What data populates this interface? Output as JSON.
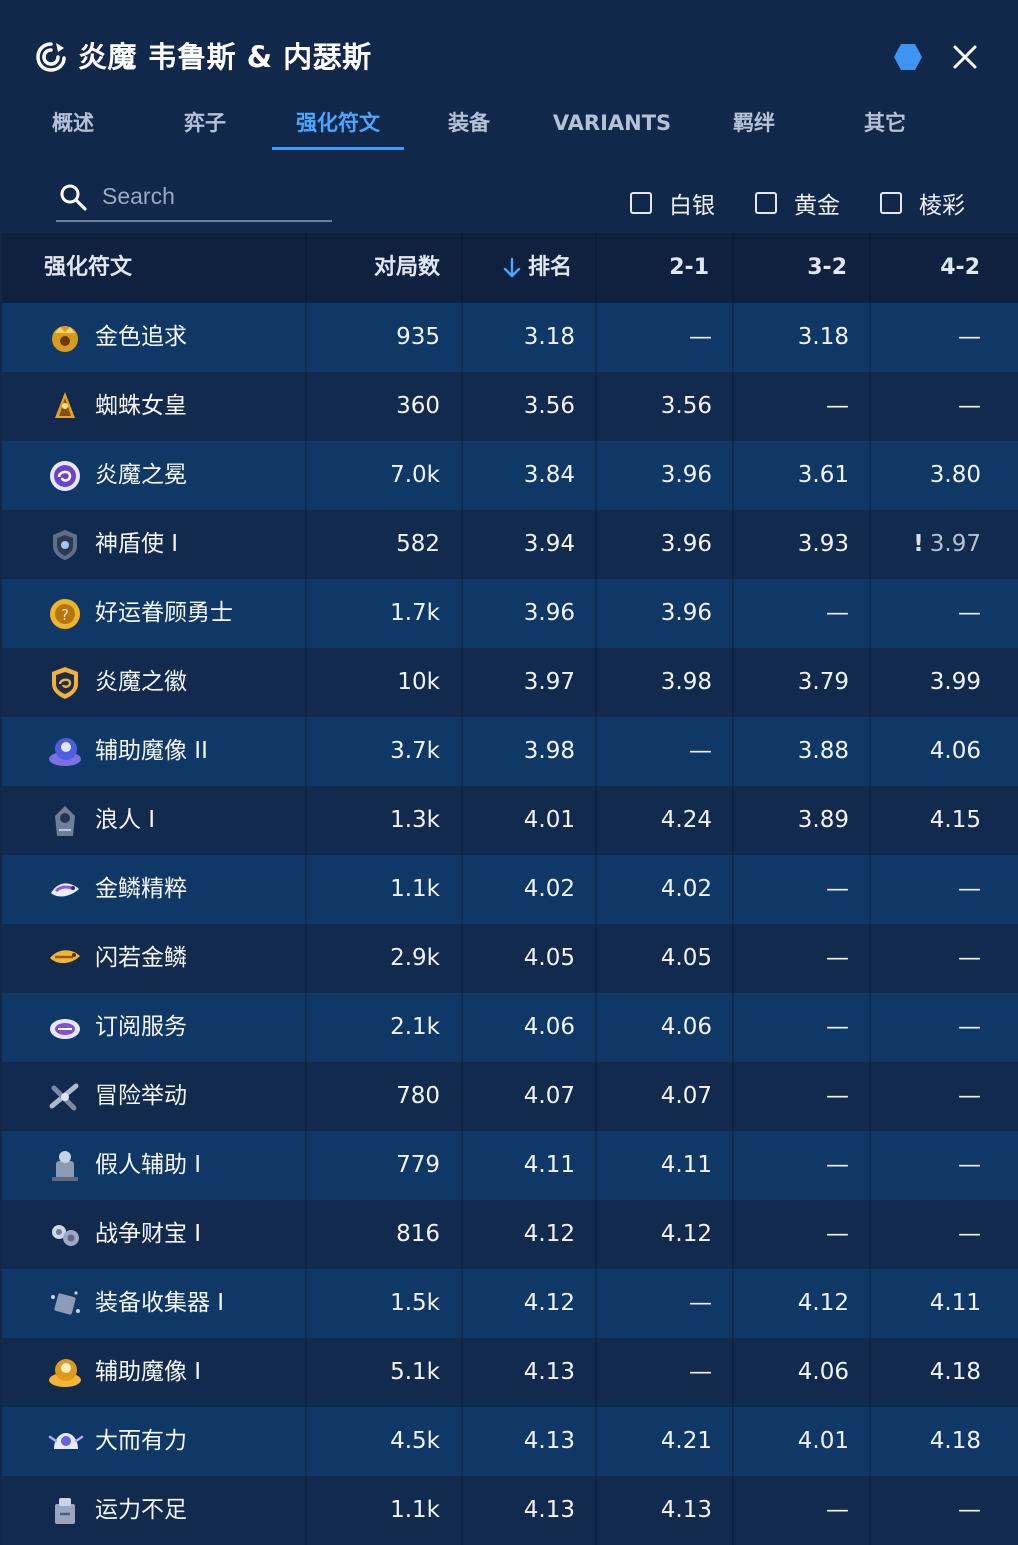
{
  "header": {
    "title": "炎魔 韦鲁斯 & 内瑟斯",
    "title_icon": "swirl-emblem-icon",
    "hex_icon": "hexagon-icon",
    "hex_color": "#3d95f2",
    "close_icon": "close-icon"
  },
  "tabs": [
    {
      "label": "概述",
      "active": false
    },
    {
      "label": "弈子",
      "active": false
    },
    {
      "label": "强化符文",
      "active": true
    },
    {
      "label": "装备",
      "active": false
    },
    {
      "label": "VARIANTS",
      "active": false
    },
    {
      "label": "羁绊",
      "active": false
    },
    {
      "label": "其它",
      "active": false
    }
  ],
  "search": {
    "placeholder": "Search",
    "value": ""
  },
  "filters": [
    {
      "label": "白银",
      "checked": false
    },
    {
      "label": "黄金",
      "checked": false
    },
    {
      "label": "棱彩",
      "checked": false
    }
  ],
  "table": {
    "columns": {
      "name": "强化符文",
      "games": "对局数",
      "rank": "排名",
      "rank_sort_icon": "arrow-down-icon",
      "s21": "2-1",
      "s32": "3-2",
      "s42": "4-2"
    },
    "rows": [
      {
        "name": "金色追求",
        "icon": "golden-pursuit-icon",
        "games": "935",
        "rank": "3.18",
        "s21": "—",
        "s32": "3.18",
        "s42": "—"
      },
      {
        "name": "蜘蛛女皇",
        "icon": "spider-queen-icon",
        "games": "360",
        "rank": "3.56",
        "s21": "3.56",
        "s32": "—",
        "s42": "—"
      },
      {
        "name": "炎魔之冕",
        "icon": "crown-emblem-icon",
        "games": "7.0k",
        "rank": "3.84",
        "s21": "3.96",
        "s32": "3.61",
        "s42": "3.80"
      },
      {
        "name": "神盾使 I",
        "icon": "shield-bearer-icon",
        "games": "582",
        "rank": "3.94",
        "s21": "3.96",
        "s32": "3.93",
        "s42": "3.97",
        "s42_warn": "!"
      },
      {
        "name": "好运眷顾勇士",
        "icon": "lucky-coin-icon",
        "games": "1.7k",
        "rank": "3.96",
        "s21": "3.96",
        "s32": "—",
        "s42": "—"
      },
      {
        "name": "炎魔之徽",
        "icon": "crest-badge-icon",
        "games": "10k",
        "rank": "3.97",
        "s21": "3.98",
        "s32": "3.79",
        "s42": "3.99"
      },
      {
        "name": "辅助魔像 II",
        "icon": "golem-blue-icon",
        "games": "3.7k",
        "rank": "3.98",
        "s21": "—",
        "s32": "3.88",
        "s42": "4.06"
      },
      {
        "name": "浪人 I",
        "icon": "ronin-icon",
        "games": "1.3k",
        "rank": "4.01",
        "s21": "4.24",
        "s32": "3.89",
        "s42": "4.15"
      },
      {
        "name": "金鳞精粹",
        "icon": "essence-fish-icon",
        "games": "1.1k",
        "rank": "4.02",
        "s21": "4.02",
        "s32": "—",
        "s42": "—"
      },
      {
        "name": "闪若金鳞",
        "icon": "golden-fish-icon",
        "games": "2.9k",
        "rank": "4.05",
        "s21": "4.05",
        "s32": "—",
        "s42": "—"
      },
      {
        "name": "订阅服务",
        "icon": "subscription-icon",
        "games": "2.1k",
        "rank": "4.06",
        "s21": "4.06",
        "s32": "—",
        "s42": "—"
      },
      {
        "name": "冒险举动",
        "icon": "risky-move-icon",
        "games": "780",
        "rank": "4.07",
        "s21": "4.07",
        "s32": "—",
        "s42": "—"
      },
      {
        "name": "假人辅助 I",
        "icon": "dummy-icon",
        "games": "779",
        "rank": "4.11",
        "s21": "4.11",
        "s32": "—",
        "s42": "—"
      },
      {
        "name": "战争财宝 I",
        "icon": "war-spoils-icon",
        "games": "816",
        "rank": "4.12",
        "s21": "4.12",
        "s32": "—",
        "s42": "—"
      },
      {
        "name": "装备收集器 I",
        "icon": "item-collector-icon",
        "games": "1.5k",
        "rank": "4.12",
        "s21": "—",
        "s32": "4.12",
        "s42": "4.11"
      },
      {
        "name": "辅助魔像 I",
        "icon": "golem-gold-icon",
        "games": "5.1k",
        "rank": "4.13",
        "s21": "—",
        "s32": "4.06",
        "s42": "4.18"
      },
      {
        "name": "大而有力",
        "icon": "big-strong-icon",
        "games": "4.5k",
        "rank": "4.13",
        "s21": "4.21",
        "s32": "4.01",
        "s42": "4.18"
      },
      {
        "name": "运力不足",
        "icon": "lacking-power-icon",
        "games": "1.1k",
        "rank": "4.13",
        "s21": "4.13",
        "s32": "—",
        "s42": "—"
      }
    ]
  }
}
